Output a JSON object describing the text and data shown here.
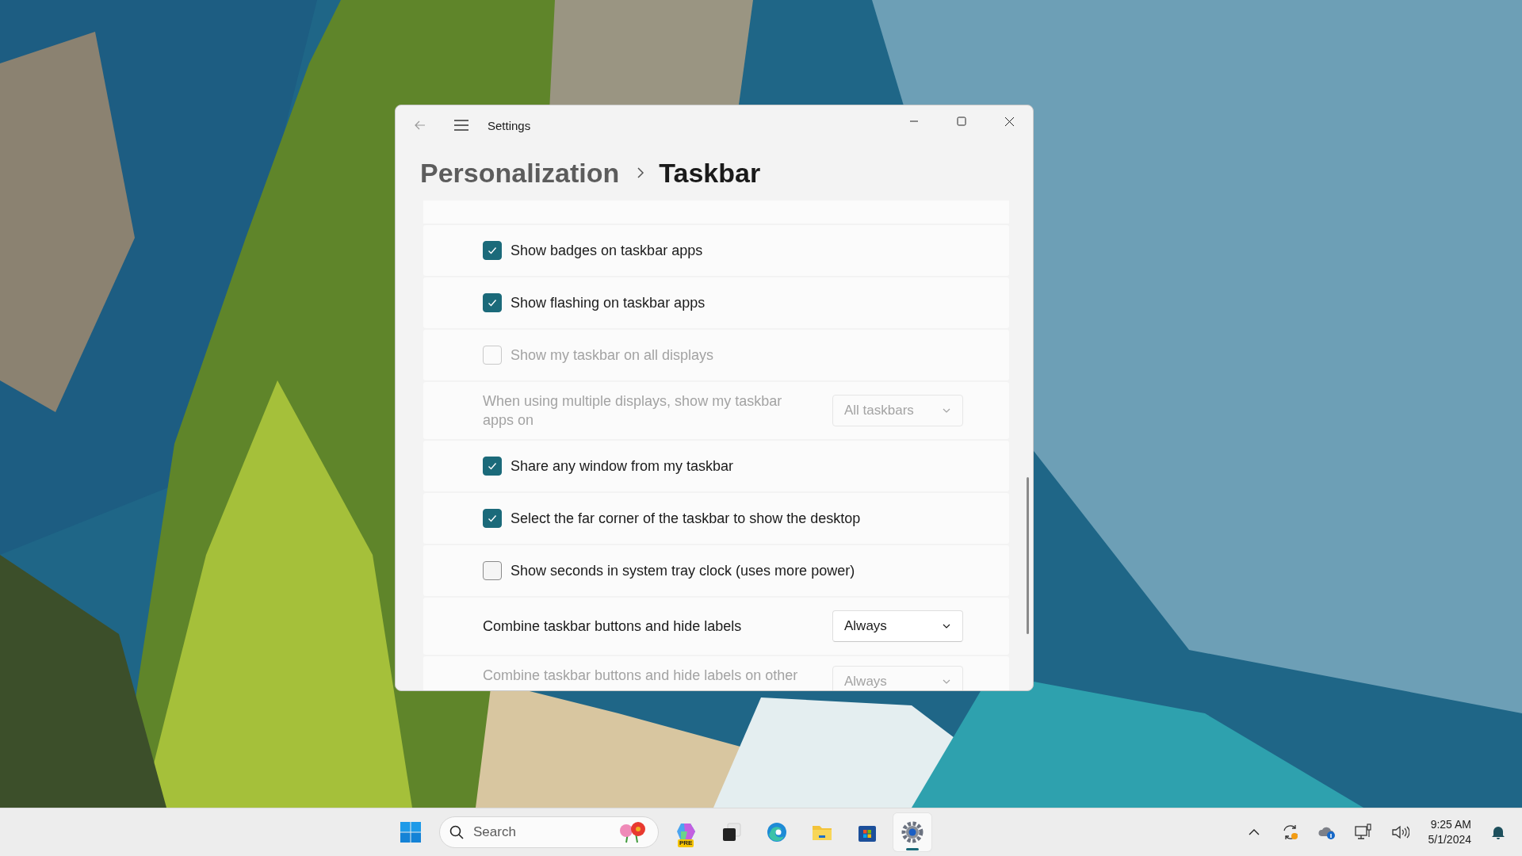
{
  "window": {
    "title": "Settings"
  },
  "breadcrumb": {
    "parent": "Personalization",
    "current": "Taskbar"
  },
  "rows": [
    {
      "kind": "checkbox",
      "label": "Show badges on taskbar apps",
      "checked": true,
      "disabled": false
    },
    {
      "kind": "checkbox",
      "label": "Show flashing on taskbar apps",
      "checked": true,
      "disabled": false
    },
    {
      "kind": "checkbox",
      "label": "Show my taskbar on all displays",
      "checked": false,
      "disabled": true
    },
    {
      "kind": "dropdown",
      "label": "When using multiple displays, show my taskbar apps on",
      "value": "All taskbars",
      "disabled": true
    },
    {
      "kind": "checkbox",
      "label": "Share any window from my taskbar",
      "checked": true,
      "disabled": false
    },
    {
      "kind": "checkbox",
      "label": "Select the far corner of the taskbar to show the desktop",
      "checked": true,
      "disabled": false
    },
    {
      "kind": "checkbox",
      "label": "Show seconds in system tray clock (uses more power)",
      "checked": false,
      "disabled": false
    },
    {
      "kind": "dropdown",
      "label": "Combine taskbar buttons and hide labels",
      "value": "Always",
      "disabled": false
    },
    {
      "kind": "dropdown",
      "label": "Combine taskbar buttons and hide labels on other",
      "value": "Always",
      "disabled": true
    }
  ],
  "taskbar": {
    "search": {
      "placeholder": "Search"
    },
    "apps": [
      {
        "kind": "copilot",
        "badge": "PRE",
        "selected": false
      },
      {
        "kind": "taskview",
        "selected": false
      },
      {
        "kind": "edge",
        "selected": false
      },
      {
        "kind": "explorer",
        "selected": false
      },
      {
        "kind": "store",
        "selected": false
      },
      {
        "kind": "settings",
        "selected": true
      }
    ],
    "clock": {
      "time": "9:25 AM",
      "date": "5/1/2024"
    }
  }
}
